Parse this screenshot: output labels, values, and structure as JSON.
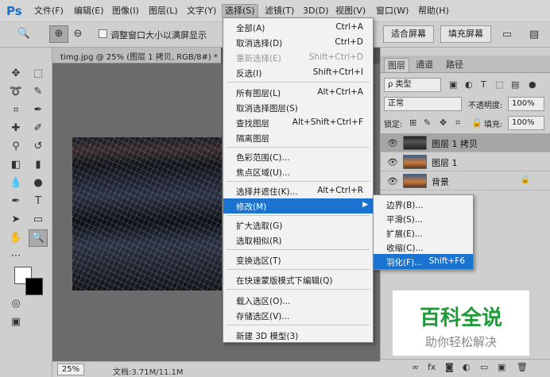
{
  "menubar": {
    "logo": "Ps",
    "items": [
      "文件(F)",
      "编辑(E)",
      "图像(I)",
      "图层(L)",
      "文字(Y)",
      "选择(S)",
      "滤镜(T)",
      "3D(D)",
      "视图(V)",
      "窗口(W)",
      "帮助(H)"
    ]
  },
  "options": {
    "resize_window_label": "调整窗口大小以满屏显示",
    "fit_screen_label": "适合屏幕",
    "fill_screen_label": "填充屏幕"
  },
  "document": {
    "tab_title": "timg.jpg @ 25% (图层 1 拷贝, RGB/8#) *",
    "zoom": "25%",
    "doc_size": "文档:3.71M/11.1M"
  },
  "layers_panel": {
    "tabs": [
      "图层",
      "通道",
      "路径"
    ],
    "filter_label": "类型",
    "blend_mode": "正常",
    "opacity_label": "不透明度:",
    "opacity_value": "100%",
    "lock_label": "锁定:",
    "fill_label": "填充:",
    "fill_value": "100%",
    "layers": [
      {
        "name": "图层 1 拷贝",
        "selected": true
      },
      {
        "name": "图层 1",
        "selected": false
      },
      {
        "name": "背景",
        "selected": false
      }
    ]
  },
  "select_menu": {
    "items": [
      {
        "label": "全部(A)",
        "shortcut": "Ctrl+A"
      },
      {
        "label": "取消选择(D)",
        "shortcut": "Ctrl+D"
      },
      {
        "label": "重新选择(E)",
        "shortcut": "Shift+Ctrl+D"
      },
      {
        "label": "反选(I)",
        "shortcut": "Shift+Ctrl+I"
      },
      {
        "label": "所有图层(L)",
        "shortcut": "Alt+Ctrl+A"
      },
      {
        "label": "取消选择图层(S)",
        "shortcut": ""
      },
      {
        "label": "查找图层",
        "shortcut": "Alt+Shift+Ctrl+F"
      },
      {
        "label": "隔离图层",
        "shortcut": ""
      },
      {
        "label": "色彩范围(C)...",
        "shortcut": ""
      },
      {
        "label": "焦点区域(U)...",
        "shortcut": ""
      },
      {
        "label": "选择并遮住(K)...",
        "shortcut": "Alt+Ctrl+R"
      },
      {
        "label": "修改(M)",
        "shortcut": ""
      },
      {
        "label": "扩大选取(G)",
        "shortcut": ""
      },
      {
        "label": "选取相似(R)",
        "shortcut": ""
      },
      {
        "label": "变换选区(T)",
        "shortcut": ""
      },
      {
        "label": "在快速蒙版模式下编辑(Q)",
        "shortcut": ""
      },
      {
        "label": "载入选区(O)...",
        "shortcut": ""
      },
      {
        "label": "存储选区(V)...",
        "shortcut": ""
      },
      {
        "label": "新建 3D 模型(3)",
        "shortcut": ""
      }
    ]
  },
  "modify_submenu": {
    "items": [
      {
        "label": "边界(B)...",
        "shortcut": ""
      },
      {
        "label": "平滑(S)...",
        "shortcut": ""
      },
      {
        "label": "扩展(E)...",
        "shortcut": ""
      },
      {
        "label": "收缩(C)...",
        "shortcut": ""
      },
      {
        "label": "羽化(F)...",
        "shortcut": "Shift+F6"
      }
    ]
  },
  "watermark": {
    "main": "百科全说",
    "sub": "助你轻松解决"
  },
  "colors": {
    "highlight": "#1b73d0",
    "watermark_green": "#1f9a3a"
  }
}
